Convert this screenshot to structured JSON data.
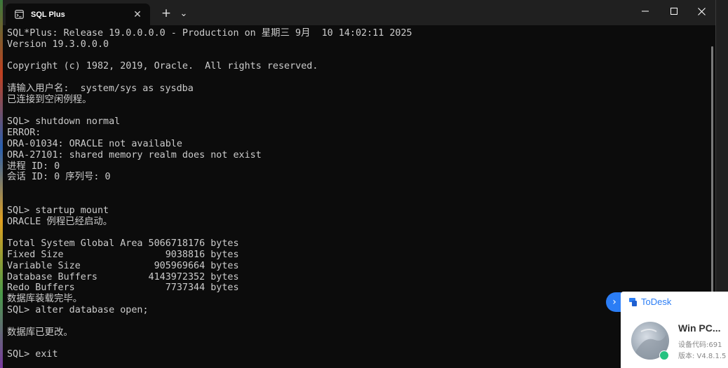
{
  "window": {
    "tab_title": "SQL Plus",
    "new_tab_glyph": "+",
    "dropdown_glyph": "⌄",
    "close_tab_glyph": "✕"
  },
  "console_lines": [
    "SQL*Plus: Release 19.0.0.0.0 - Production on 星期三 9月  10 14:02:11 2025",
    "Version 19.3.0.0.0",
    "",
    "Copyright (c) 1982, 2019, Oracle.  All rights reserved.",
    "",
    "请输入用户名:  system/sys as sysdba",
    "已连接到空闲例程。",
    "",
    "SQL> shutdown normal",
    "ERROR:",
    "ORA-01034: ORACLE not available",
    "ORA-27101: shared memory realm does not exist",
    "进程 ID: 0",
    "会话 ID: 0 序列号: 0",
    "",
    "",
    "SQL> startup mount",
    "ORACLE 例程已经启动。",
    "",
    "Total System Global Area 5066718176 bytes",
    "Fixed Size                  9038816 bytes",
    "Variable Size             905969664 bytes",
    "Database Buffers         4143972352 bytes",
    "Redo Buffers                7737344 bytes",
    "数据库装载完毕。",
    "SQL> alter database open;",
    "",
    "数据库已更改。",
    "",
    "SQL> exit"
  ],
  "todesk": {
    "brand": "ToDesk",
    "toggle_glyph": "›",
    "device_name": "Win PC...",
    "device_code": "设备代码:691",
    "version": "版本: V4.8.1.5"
  },
  "colors": {
    "console_bg": "#0c0c0c",
    "console_fg": "#cccccc",
    "titlebar_bg": "#202020",
    "todesk_accent": "#2b7df5"
  }
}
